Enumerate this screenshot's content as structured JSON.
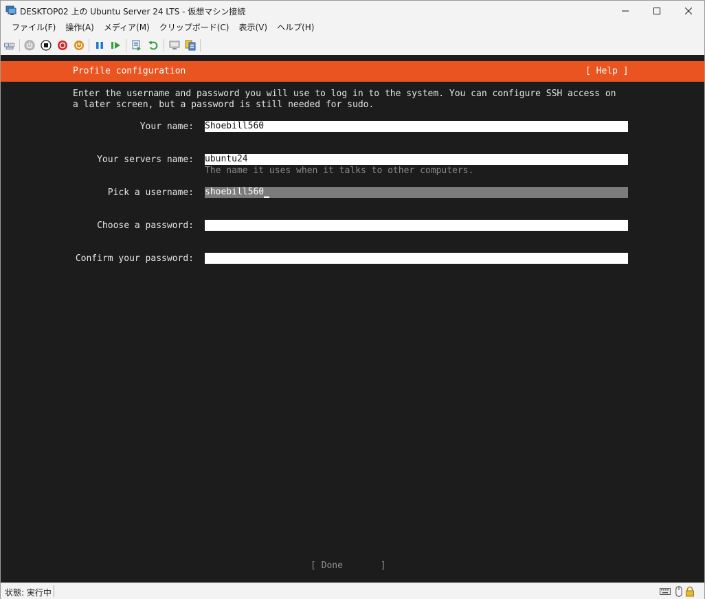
{
  "window": {
    "title": "DESKTOP02 上の Ubuntu Server 24 LTS  - 仮想マシン接続"
  },
  "menu": {
    "items": [
      {
        "label": "ファイル(F)"
      },
      {
        "label": "操作(A)"
      },
      {
        "label": "メディア(M)"
      },
      {
        "label": "クリップボード(C)"
      },
      {
        "label": "表示(V)"
      },
      {
        "label": "ヘルプ(H)"
      }
    ]
  },
  "toolbar": {
    "icons": [
      "ctrl-alt-del-icon",
      "start-icon",
      "turn-off-icon",
      "shut-down-icon",
      "power-icon",
      "pause-icon",
      "resume-icon",
      "checkpoint-icon",
      "revert-icon",
      "enhanced-session-icon",
      "share-icon"
    ]
  },
  "installer": {
    "header_title": "Profile configuration",
    "help_label": "[ Help ]",
    "description_line1": "Enter the username and password you will use to log in to the system. You can configure SSH access on",
    "description_line2": "a later screen, but a password is still needed for sudo.",
    "fields": {
      "your_name": {
        "label": "Your name:",
        "value": "Shoebill560"
      },
      "server_name": {
        "label": "Your servers name:",
        "value": "ubuntu24",
        "hint": "The name it uses when it talks to other computers."
      },
      "username": {
        "label": "Pick a username:",
        "value": "shoebill560"
      },
      "password": {
        "label": "Choose a password:",
        "value": ""
      },
      "confirm_password": {
        "label": "Confirm your password:",
        "value": ""
      }
    },
    "done_label": "[ Done       ]"
  },
  "statusbar": {
    "status": "状態: 実行中"
  },
  "colors": {
    "ubuntu_orange": "#e95420",
    "console_bg": "#1c1c1c"
  }
}
